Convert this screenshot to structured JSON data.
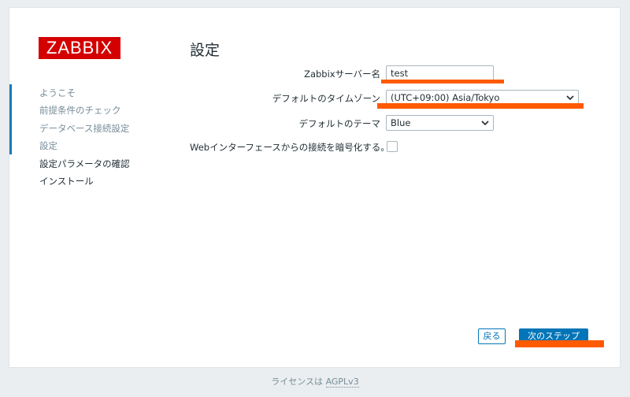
{
  "logo": "ZABBIX",
  "nav": {
    "items": [
      {
        "label": "ようこそ",
        "state": "done"
      },
      {
        "label": "前提条件のチェック",
        "state": "done"
      },
      {
        "label": "データベース接続設定",
        "state": "done"
      },
      {
        "label": "設定",
        "state": "current"
      },
      {
        "label": "設定パラメータの確認",
        "state": "todo"
      },
      {
        "label": "インストール",
        "state": "todo"
      }
    ]
  },
  "page": {
    "title": "設定"
  },
  "form": {
    "server_name_label": "Zabbixサーバー名",
    "server_name_value": "test",
    "timezone_label": "デフォルトのタイムゾーン",
    "timezone_value": "(UTC+09:00) Asia/Tokyo",
    "theme_label": "デフォルトのテーマ",
    "theme_value": "Blue",
    "encrypt_label": "Webインターフェースからの接続を暗号化する。",
    "encrypt_checked": false
  },
  "buttons": {
    "back": "戻る",
    "next": "次のステップ"
  },
  "footer": {
    "prefix": "ライセンスは",
    "link": "AGPLv3"
  },
  "colors": {
    "accent": "#0275b8",
    "brand": "#d40000",
    "highlight": "#ff5a00"
  }
}
